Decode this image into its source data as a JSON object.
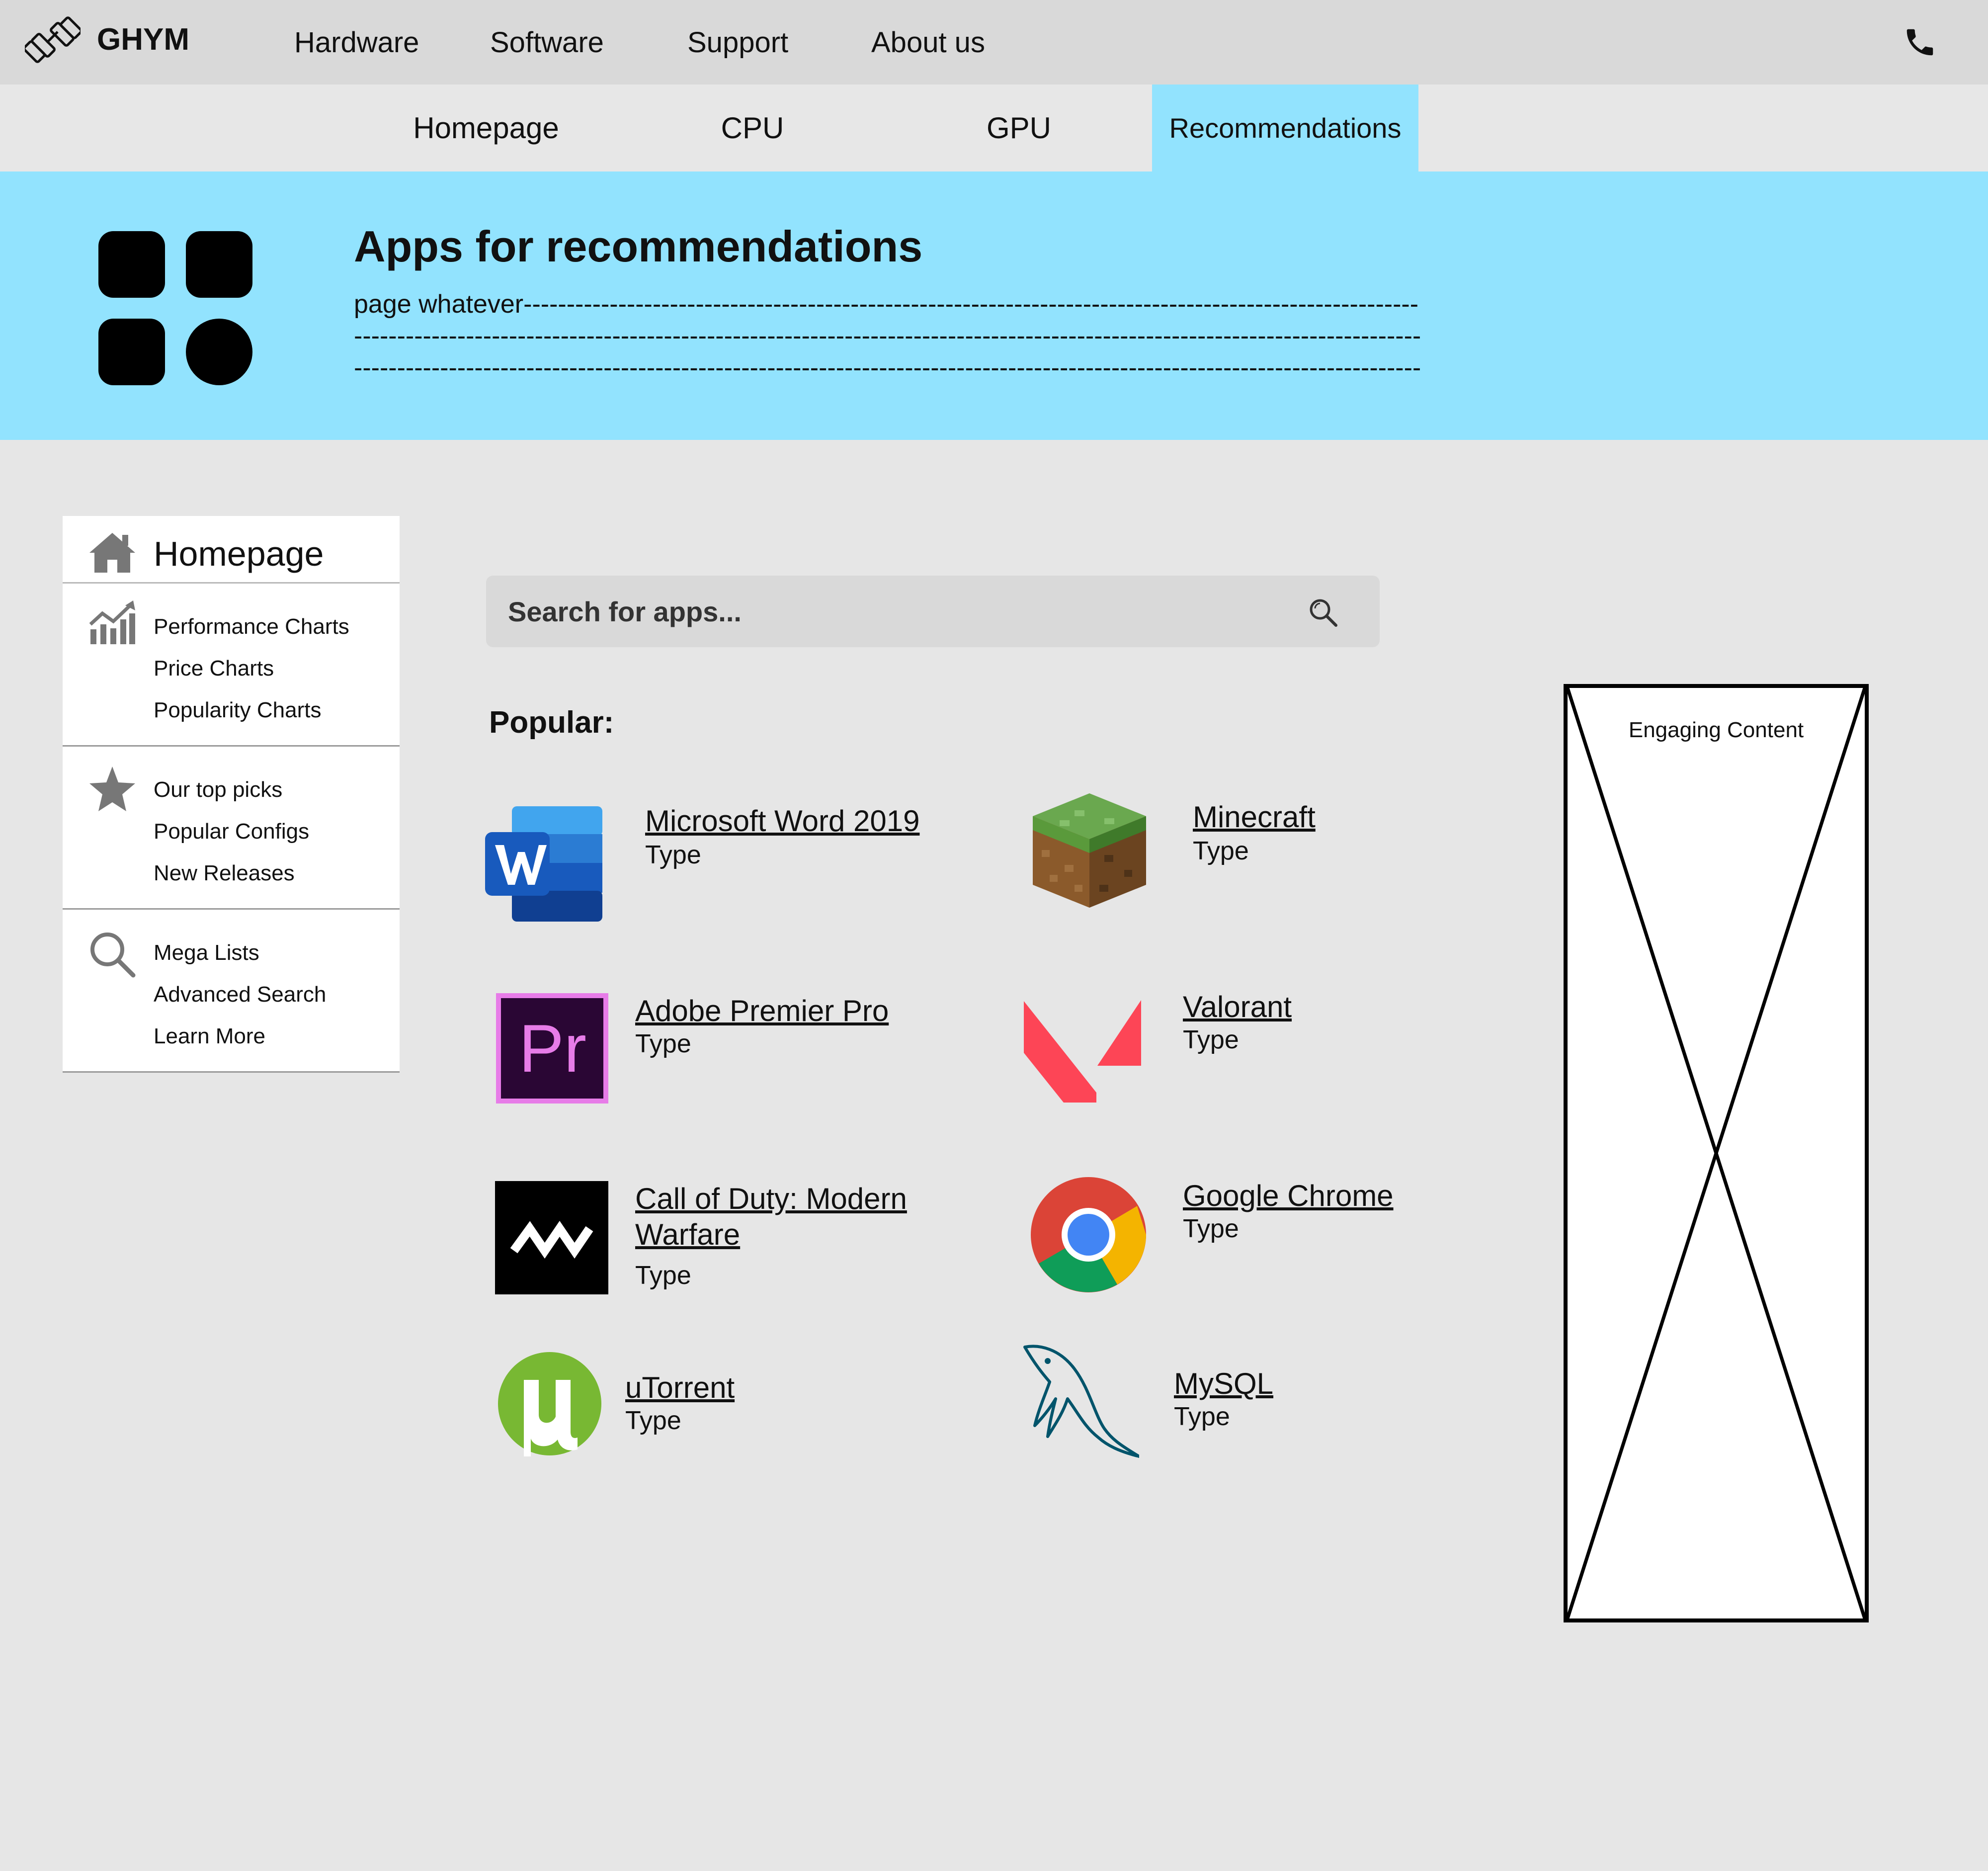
{
  "header": {
    "logo_text": "GHYM",
    "nav": [
      "Hardware",
      "Software",
      "Support",
      "About us"
    ]
  },
  "subnav": {
    "tabs": [
      "Homepage",
      "CPU",
      "GPU",
      "Recommendations"
    ],
    "active": "Recommendations"
  },
  "banner": {
    "title": "Apps for recommendations",
    "description": "page whatever---------------------------------------------------------------------------------------------------------------------------------------------------------------------------------------------------------------------------------------------------------------------------------------------------------------------------------------------------------------------------------------------------------------------------------------------------------"
  },
  "sidebar": {
    "home_label": "Homepage",
    "groups": [
      {
        "icon": "chart-icon",
        "items": [
          "Performance Charts",
          "Price Charts",
          "Popularity Charts"
        ]
      },
      {
        "icon": "star-icon",
        "items": [
          "Our top picks",
          "Popular Configs",
          "New Releases"
        ]
      },
      {
        "icon": "search-icon",
        "items": [
          "Mega Lists",
          "Advanced Search",
          "Learn More"
        ]
      }
    ]
  },
  "search": {
    "placeholder": "Search for apps..."
  },
  "popular": {
    "label": "Popular:",
    "apps": [
      {
        "name": "Microsoft Word 2019",
        "type": "Type",
        "icon": "word-icon"
      },
      {
        "name": "Minecraft",
        "type": "Type",
        "icon": "minecraft-icon"
      },
      {
        "name": "Adobe Premier Pro",
        "type": "Type",
        "icon": "premiere-icon"
      },
      {
        "name": "Valorant",
        "type": "Type",
        "icon": "valorant-icon"
      },
      {
        "name": "Call of Duty: Modern Warfare",
        "type": "Type",
        "icon": "cod-mw-icon"
      },
      {
        "name": "Google Chrome",
        "type": "Type",
        "icon": "chrome-icon"
      },
      {
        "name": "uTorrent",
        "type": "Type",
        "icon": "utorrent-icon"
      },
      {
        "name": "MySQL",
        "type": "Type",
        "icon": "mysql-icon"
      }
    ]
  },
  "ad": {
    "label": "Engaging Content"
  },
  "colors": {
    "accent": "#92e3fe",
    "topbar": "#d9d9d9",
    "page": "#e6e6e6"
  }
}
